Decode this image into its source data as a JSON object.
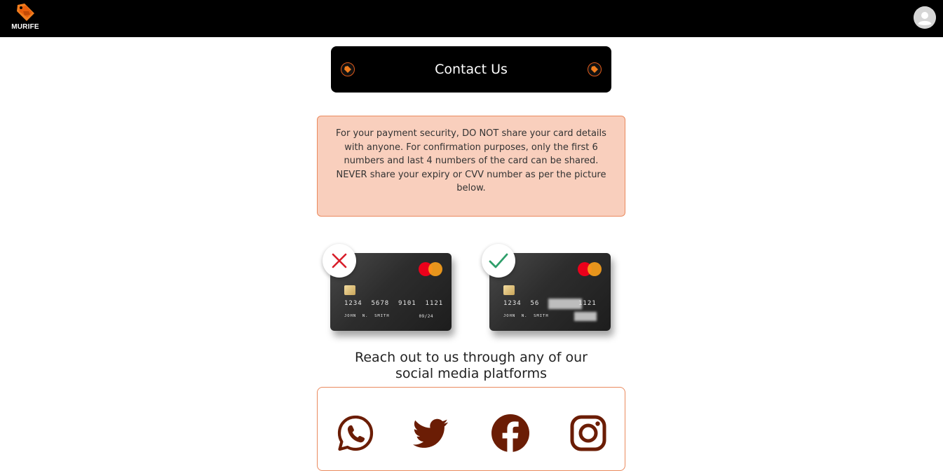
{
  "header": {
    "brand": "MURIFE",
    "logo_icon": "price-tag-icon",
    "avatar_icon": "user-avatar-icon"
  },
  "contact": {
    "title": "Contact Us"
  },
  "notice": {
    "text": "For your payment security, DO NOT share your card details with anyone. For confirmation purposes, only the first 6 numbers and last 4 numbers of the card can be shared. NEVER share your expiry or CVV number as per the picture below."
  },
  "cards": {
    "bad": {
      "status_icon": "cross-icon",
      "number": "1234  5678  9101  1121",
      "name": "JOHN  N.  SMITH",
      "expiry": "09/24"
    },
    "good": {
      "status_icon": "check-icon",
      "number_start": "1234  56",
      "number_end": "1121",
      "name": "JOHN  N.  SMITH"
    }
  },
  "social": {
    "heading": "Reach out to us through any of our social media platforms",
    "items": [
      "whatsapp-icon",
      "twitter-icon",
      "facebook-icon",
      "instagram-icon"
    ]
  },
  "colors": {
    "header_bg": "#000000",
    "accent": "#ea8a5e",
    "notice_bg": "#f9cfbd",
    "social_icon": "#6b1d05",
    "error_red": "#d81e2a",
    "success_green": "#2e9e6a"
  }
}
